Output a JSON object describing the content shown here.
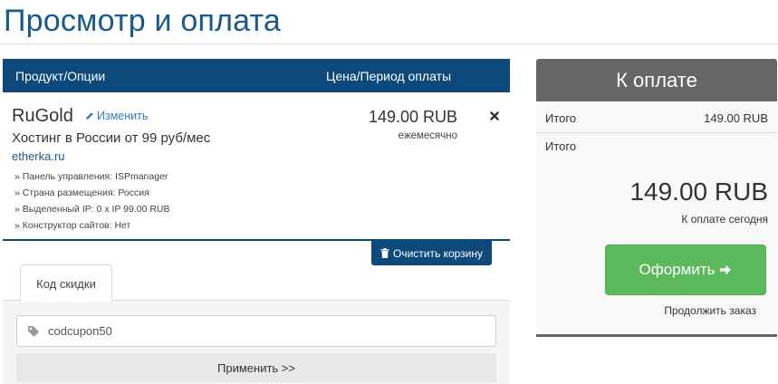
{
  "page": {
    "title": "Просмотр и оплата"
  },
  "cart": {
    "header": {
      "product_col": "Продукт/Опции",
      "price_col": "Цена/Период оплаты"
    },
    "item": {
      "name": "RuGold",
      "edit_label": "Изменить",
      "group": "Хостинг в России от 99 руб/мес",
      "domain": "etherka.ru",
      "options": [
        "» Панель управления: ISPmanager",
        "» Страна размещения: Россия",
        "» Выделенный IP: 0 x IP 99.00 RUB",
        "» Конструктор сайтов: Нет"
      ],
      "price": "149.00 RUB",
      "cycle": "ежемесячно",
      "remove_icon": "×-icon"
    },
    "clear_label": "Очистить корзину"
  },
  "promo": {
    "tab_label": "Код скидки",
    "input_value": "codcupon50",
    "apply_label": "Применить >>"
  },
  "summary": {
    "header": "К оплате",
    "subtotal_label": "Итого",
    "subtotal_value": "149.00 RUB",
    "total_label": "Итого",
    "total_amount": "149.00 RUB",
    "total_caption": "К оплате сегодня",
    "checkout_label": "Оформить",
    "continue_label": "Продолжить заказ"
  },
  "colors": {
    "title": "#1a5a8a",
    "cart_header": "#0d4a7b",
    "summary_header": "#666666",
    "checkout": "#5cb85c"
  }
}
